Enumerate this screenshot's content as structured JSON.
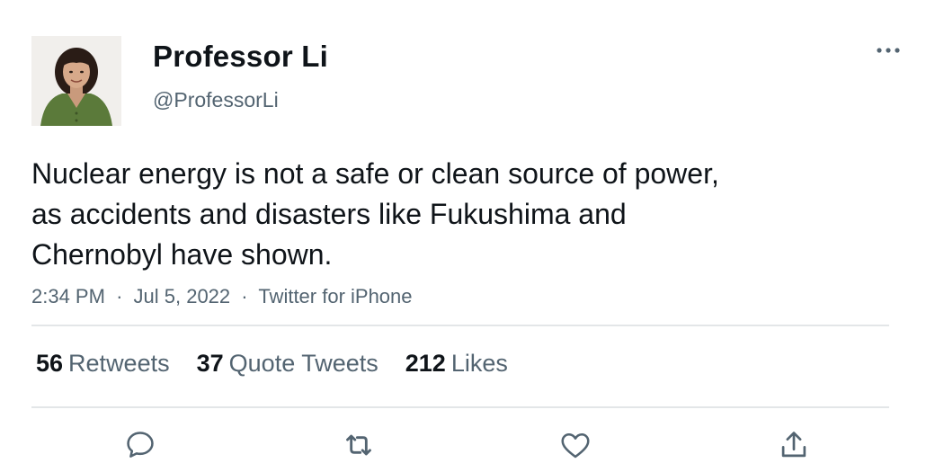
{
  "author": {
    "display_name": "Professor Li",
    "handle": "@ProfessorLi",
    "avatar_icon": "user-photo"
  },
  "tweet": {
    "text_lines": [
      "Nuclear energy is not a safe or clean source of power,",
      "as accidents and disasters like Fukushima and",
      "Chernobyl have shown."
    ],
    "time": "2:34 PM",
    "date": "Jul 5, 2022",
    "source": "Twitter for iPhone",
    "separator": "·"
  },
  "stats": {
    "retweets": {
      "count": "56",
      "label": "Retweets"
    },
    "quote_tweets": {
      "count": "37",
      "label": "Quote Tweets"
    },
    "likes": {
      "count": "212",
      "label": "Likes"
    }
  },
  "actions": [
    "reply-icon",
    "retweet-icon",
    "like-icon",
    "share-icon"
  ],
  "menu": {
    "icon": "more-icon"
  },
  "colors": {
    "text": "#0f1419",
    "secondary": "#536471",
    "divider": "#e3e6e8",
    "icon": "#536471"
  }
}
